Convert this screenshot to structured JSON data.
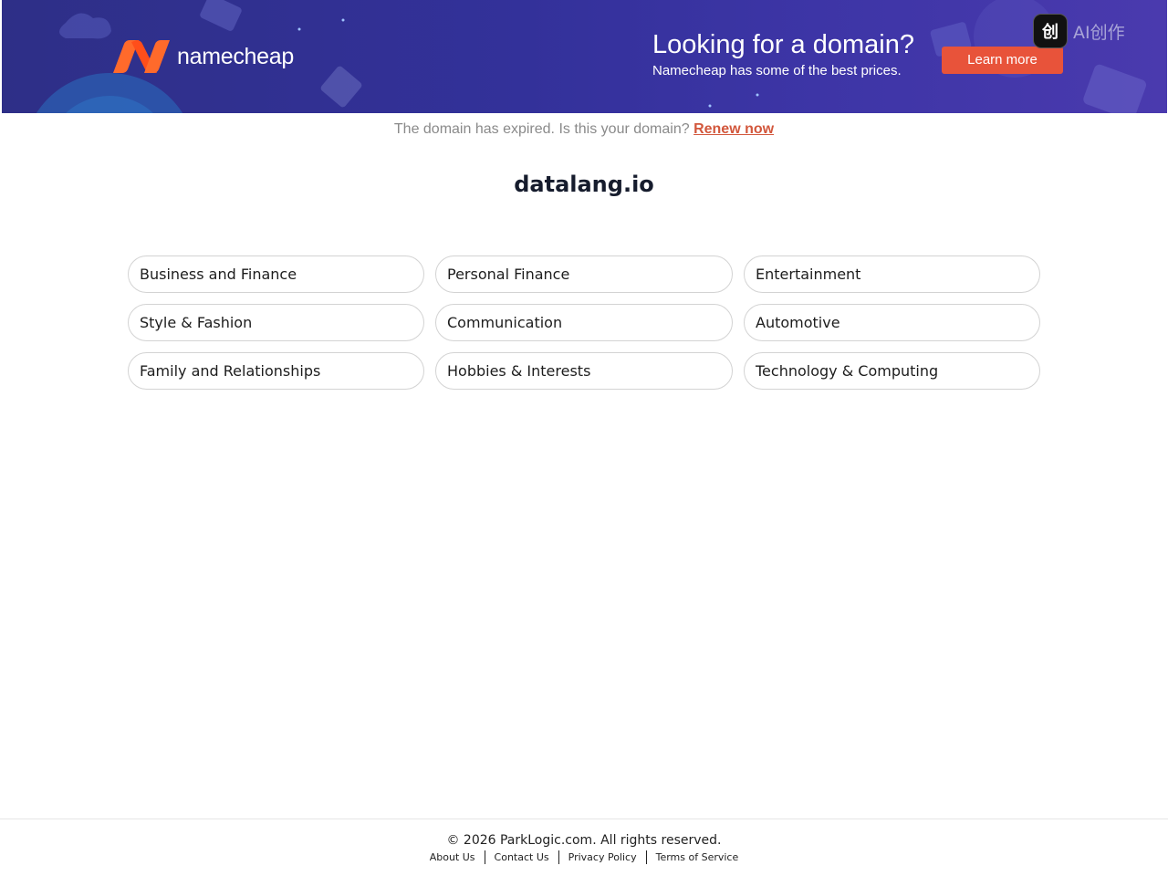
{
  "banner": {
    "brand": "namecheap",
    "headline": "Looking for a domain?",
    "subline": "Namecheap has some of the best prices.",
    "cta_label": "Learn more",
    "brand_color": "#ff5a1f",
    "background_color": "#33319a",
    "cta_color": "#e8533a"
  },
  "overlay": {
    "icon_glyph": "创",
    "text": "AI创作"
  },
  "notice": {
    "text": "The domain has expired. Is this your domain?",
    "link_label": "Renew now"
  },
  "domain": "datalang.io",
  "categories": [
    "Business and Finance",
    "Personal Finance",
    "Entertainment",
    "Style & Fashion",
    "Communication",
    "Automotive",
    "Family and Relationships",
    "Hobbies & Interests",
    "Technology & Computing"
  ],
  "footer": {
    "copyright": "© 2026 ParkLogic.com. All rights reserved.",
    "links": [
      "About Us",
      "Contact Us",
      "Privacy Policy",
      "Terms of Service"
    ]
  }
}
